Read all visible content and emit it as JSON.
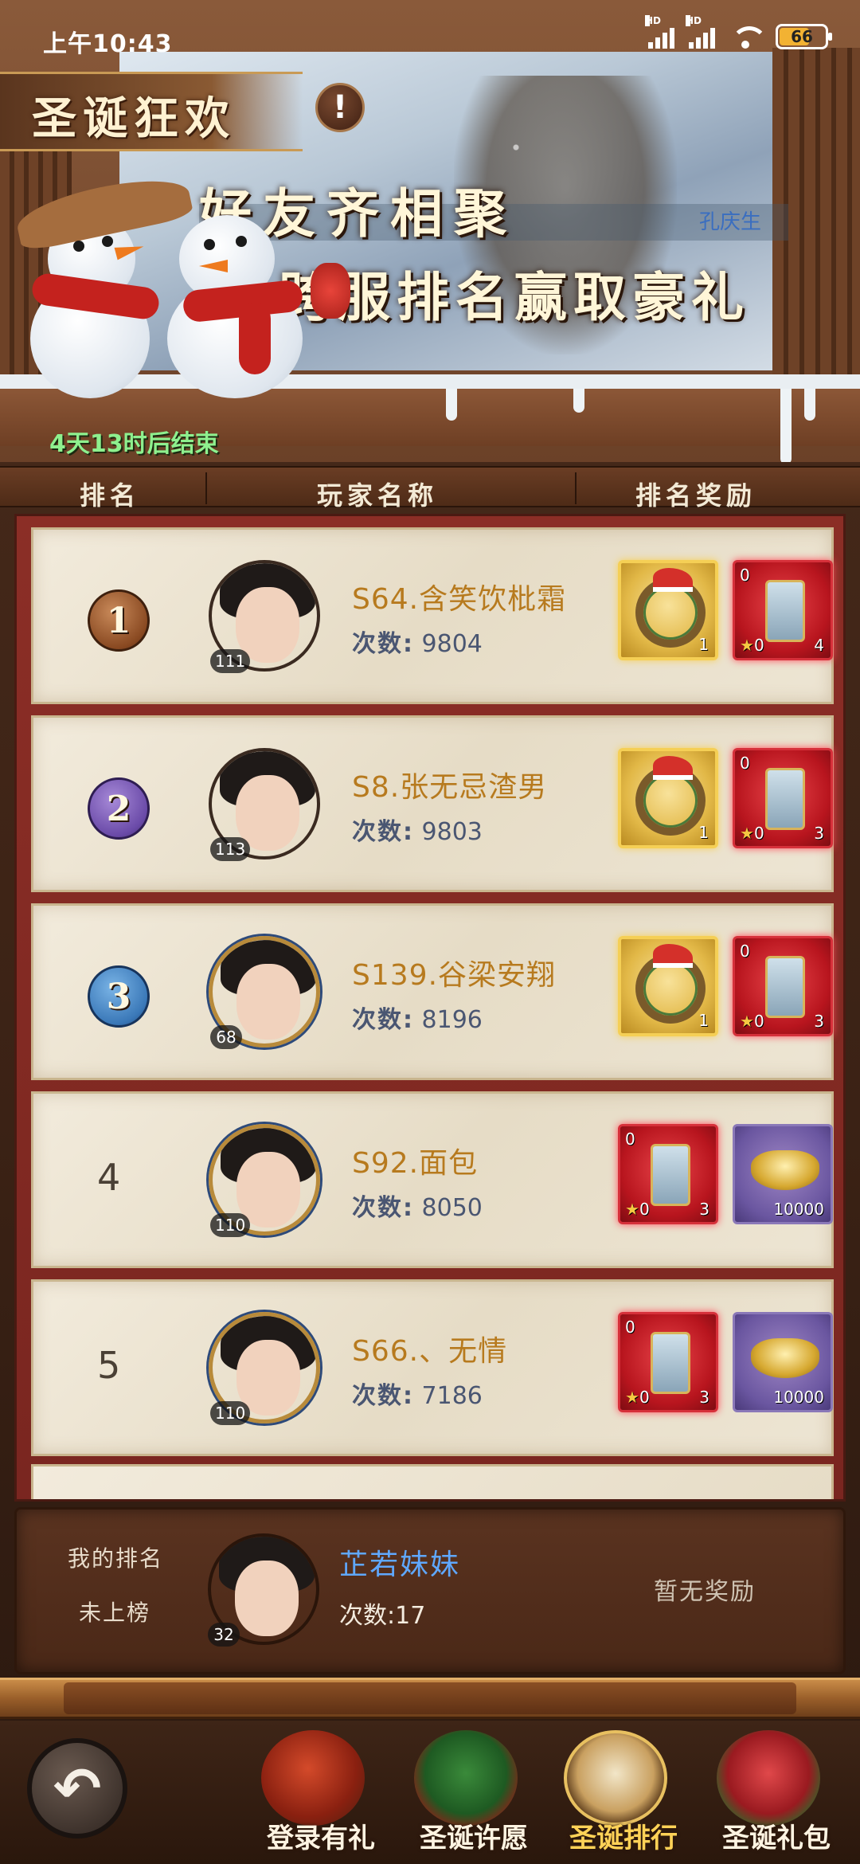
{
  "status_bar": {
    "time": "上午10:43",
    "signal_hd_1": "HD",
    "signal_hd_2": "HD",
    "battery": "66"
  },
  "banner": {
    "title": "圣诞狂欢",
    "info_icon": "!",
    "slogan_1": "好友齐相聚",
    "slogan_2": "跨服排名赢取豪礼",
    "scroll_name": "孔庆生",
    "countdown": "4天13时后结束"
  },
  "columns": {
    "rank": "排名",
    "player": "玩家名称",
    "reward": "排名奖励"
  },
  "rows": [
    {
      "rank": "1",
      "name": "S64.含笑饮枇霜",
      "count_label": "次数:",
      "count": "9804",
      "level": "111",
      "rewards": [
        {
          "type": "wreath",
          "style": "gold",
          "qty": "1"
        },
        {
          "type": "scroll",
          "style": "red",
          "tl": "0",
          "stars": "0",
          "qty": "4"
        }
      ]
    },
    {
      "rank": "2",
      "name": "S8.张无忌渣男",
      "count_label": "次数:",
      "count": "9803",
      "level": "113",
      "rewards": [
        {
          "type": "wreath",
          "style": "gold",
          "qty": "1"
        },
        {
          "type": "scroll",
          "style": "red",
          "tl": "0",
          "stars": "0",
          "qty": "3"
        }
      ]
    },
    {
      "rank": "3",
      "name": "S139.谷梁安翔",
      "count_label": "次数:",
      "count": "8196",
      "level": "68",
      "rewards": [
        {
          "type": "wreath",
          "style": "gold",
          "qty": "1"
        },
        {
          "type": "scroll",
          "style": "red",
          "tl": "0",
          "stars": "0",
          "qty": "3"
        }
      ]
    },
    {
      "rank": "4",
      "name": "S92.面包",
      "count_label": "次数:",
      "count": "8050",
      "level": "110",
      "rewards": [
        {
          "type": "scroll",
          "style": "red",
          "tl": "0",
          "stars": "0",
          "qty": "3"
        },
        {
          "type": "ingot",
          "style": "purple",
          "qty": "10000"
        }
      ]
    },
    {
      "rank": "5",
      "name": "S66.、无情",
      "count_label": "次数:",
      "count": "7186",
      "level": "110",
      "rewards": [
        {
          "type": "scroll",
          "style": "red",
          "tl": "0",
          "stars": "0",
          "qty": "3"
        },
        {
          "type": "ingot",
          "style": "purple",
          "qty": "10000"
        }
      ]
    }
  ],
  "my_rank": {
    "label": "我的排名",
    "status": "未上榜",
    "name": "芷若妹妹",
    "count_text": "次数:17",
    "level": "32",
    "reward_text": "暂无奖励"
  },
  "nav": {
    "back_icon": "↶",
    "items": [
      {
        "label": "登录有礼",
        "icon": "gift-bag-icon"
      },
      {
        "label": "圣诞许愿",
        "icon": "christmas-tree-icon"
      },
      {
        "label": "圣诞排行",
        "icon": "ranking-board-icon",
        "active": true
      },
      {
        "label": "圣诞礼包",
        "icon": "gift-box-icon"
      }
    ]
  },
  "colors": {
    "rank_name": "#b77a1e",
    "my_name": "#5fa8ff",
    "countdown": "#8ef08e",
    "list_bg": "#8b2e26"
  }
}
